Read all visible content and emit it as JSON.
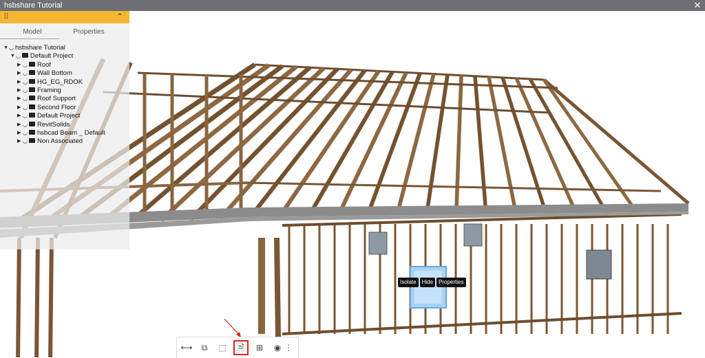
{
  "window": {
    "title": "hsbshare Tutorial",
    "close_icon": "close-icon"
  },
  "panel": {
    "collapse_icon": "chevron-up-icon",
    "tabs": [
      {
        "label": "Model"
      },
      {
        "label": "Properties"
      }
    ],
    "tree": [
      {
        "label": "hsbshare Tutorial",
        "level": 0,
        "expanded": true,
        "folder": false
      },
      {
        "label": "Default Project",
        "level": 1,
        "expanded": true,
        "folder": true
      },
      {
        "label": "Roof",
        "level": 2,
        "expanded": false,
        "folder": true
      },
      {
        "label": "Wall Bottom",
        "level": 2,
        "expanded": false,
        "folder": true
      },
      {
        "label": "HG_EG_RDOK",
        "level": 2,
        "expanded": false,
        "folder": true
      },
      {
        "label": "Framing",
        "level": 2,
        "expanded": false,
        "folder": true
      },
      {
        "label": "Roof Support",
        "level": 2,
        "expanded": false,
        "folder": true
      },
      {
        "label": "Second Floor",
        "level": 2,
        "expanded": false,
        "folder": true
      },
      {
        "label": "Default Project",
        "level": 2,
        "expanded": false,
        "folder": true
      },
      {
        "label": "RevitSolids",
        "level": 2,
        "expanded": false,
        "folder": true
      },
      {
        "label": "hsbcad Beam _ Default",
        "level": 2,
        "expanded": false,
        "folder": true
      },
      {
        "label": "Non Associated",
        "level": 2,
        "expanded": false,
        "folder": true
      }
    ]
  },
  "context_menu": {
    "isolate": "Isolate",
    "hide": "Hide",
    "properties": "Properties"
  },
  "toolbar": {
    "buttons": [
      {
        "icon": "measure-icon"
      },
      {
        "icon": "section-box-icon"
      },
      {
        "icon": "select-area-icon"
      },
      {
        "icon": "export-file-icon",
        "highlighted": true
      },
      {
        "icon": "add-file-icon"
      },
      {
        "icon": "visibility-eye-icon"
      },
      {
        "icon": "more-options-icon"
      }
    ]
  },
  "colors": {
    "title_bar": "#6f7073",
    "panel_header": "#f5b731",
    "timber": "#8a6540",
    "highlight": "#e02020",
    "selected_window": "#a9d2f7"
  }
}
